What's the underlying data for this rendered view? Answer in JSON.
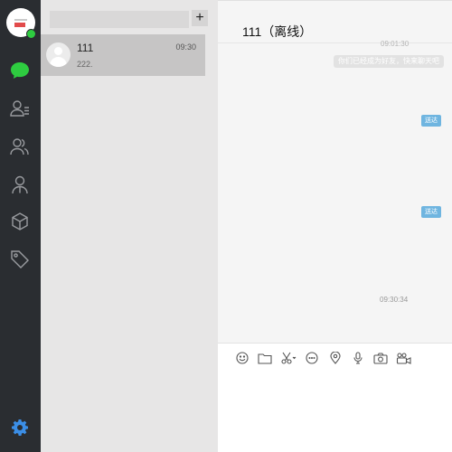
{
  "nav": {
    "items": [
      {
        "name": "chat-icon",
        "color": "#2ecc40"
      },
      {
        "name": "contacts-icon"
      },
      {
        "name": "group-icon"
      },
      {
        "name": "user-icon"
      },
      {
        "name": "cube-icon"
      },
      {
        "name": "tag-icon"
      }
    ],
    "settings_icon": "gear-icon",
    "settings_color": "#3b8ee6"
  },
  "list": {
    "search_placeholder": "",
    "add_button": "+",
    "conversations": [
      {
        "name": "111",
        "time": "09:30",
        "preview": "222."
      }
    ]
  },
  "chat": {
    "title": "111（离线）",
    "timestamp_top": "09:01:30",
    "system_message": "你们已经成为好友，快来聊天吧",
    "messages": [
      {
        "status": "送达"
      },
      {
        "status": "送达"
      }
    ],
    "timestamp_mid": "09:30:34",
    "toolbar": [
      "emoji-icon",
      "folder-icon",
      "scissors-icon",
      "chat-bubble-icon",
      "location-icon",
      "microphone-icon",
      "camera-icon",
      "video-icon"
    ]
  },
  "colors": {
    "sidebar_bg": "#2a2d31",
    "online": "#2ecc40",
    "status_badge": "#6fb5e0"
  }
}
